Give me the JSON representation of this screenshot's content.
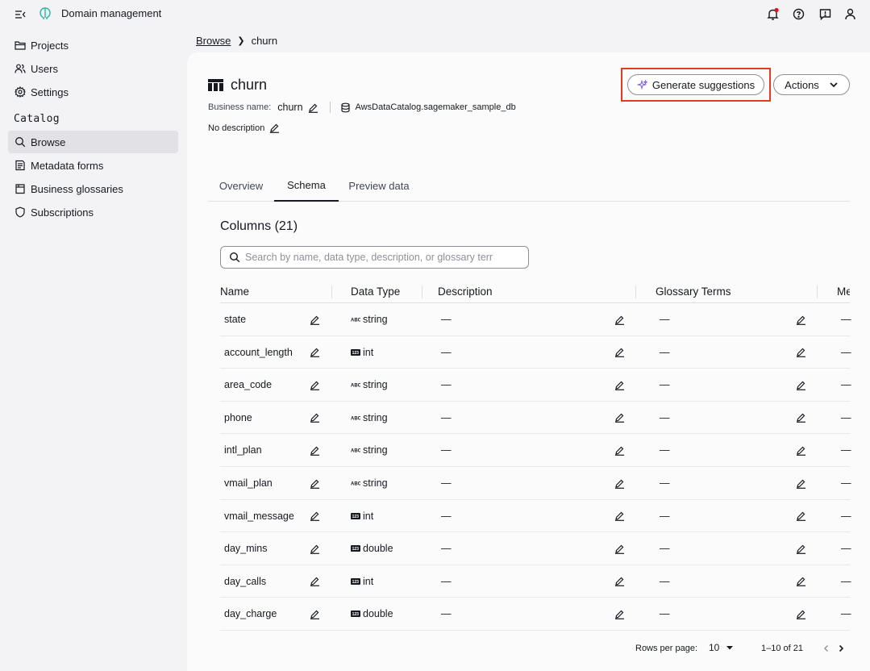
{
  "topbar": {
    "app_title": "Domain management",
    "notification_dot_color": "#d91515"
  },
  "sidebar": {
    "items": [
      {
        "label": "Projects",
        "icon": "folder-icon"
      },
      {
        "label": "Users",
        "icon": "users-icon"
      },
      {
        "label": "Settings",
        "icon": "gear-icon"
      }
    ],
    "section_label": "Catalog",
    "catalog_items": [
      {
        "label": "Browse",
        "icon": "search-icon",
        "active": true
      },
      {
        "label": "Metadata forms",
        "icon": "form-icon"
      },
      {
        "label": "Business glossaries",
        "icon": "book-icon"
      },
      {
        "label": "Subscriptions",
        "icon": "shield-icon"
      }
    ]
  },
  "breadcrumb": {
    "parent": "Browse",
    "current": "churn"
  },
  "header": {
    "title": "churn",
    "business_name_label": "Business name:",
    "business_name": "churn",
    "database": "AwsDataCatalog.sagemaker_sample_db",
    "description": "No description",
    "generate_label": "Generate suggestions",
    "actions_label": "Actions",
    "highlight_color": "#e8391f"
  },
  "tabs": [
    {
      "label": "Overview",
      "active": false
    },
    {
      "label": "Schema",
      "active": true
    },
    {
      "label": "Preview data",
      "active": false
    }
  ],
  "columns": {
    "title": "Columns (21)",
    "search_placeholder": "Search by name, data type, description, or glossary terr",
    "headers": [
      "Name",
      "Data Type",
      "Description",
      "Glossary Terms",
      "Me"
    ],
    "rows": [
      {
        "name": "state",
        "type": "string",
        "type_icon": "abc-icon",
        "description": "—",
        "glossary": "—",
        "meta": "—"
      },
      {
        "name": "account_length",
        "type": "int",
        "type_icon": "123-icon",
        "description": "—",
        "glossary": "—",
        "meta": "—"
      },
      {
        "name": "area_code",
        "type": "string",
        "type_icon": "abc-icon",
        "description": "—",
        "glossary": "—",
        "meta": "—"
      },
      {
        "name": "phone",
        "type": "string",
        "type_icon": "abc-icon",
        "description": "—",
        "glossary": "—",
        "meta": "—"
      },
      {
        "name": "intl_plan",
        "type": "string",
        "type_icon": "abc-icon",
        "description": "—",
        "glossary": "—",
        "meta": "—"
      },
      {
        "name": "vmail_plan",
        "type": "string",
        "type_icon": "abc-icon",
        "description": "—",
        "glossary": "—",
        "meta": "—"
      },
      {
        "name": "vmail_message",
        "type": "int",
        "type_icon": "123-icon",
        "description": "—",
        "glossary": "—",
        "meta": "—"
      },
      {
        "name": "day_mins",
        "type": "double",
        "type_icon": "123-icon",
        "description": "—",
        "glossary": "—",
        "meta": "—"
      },
      {
        "name": "day_calls",
        "type": "int",
        "type_icon": "123-icon",
        "description": "—",
        "glossary": "—",
        "meta": "—"
      },
      {
        "name": "day_charge",
        "type": "double",
        "type_icon": "123-icon",
        "description": "—",
        "glossary": "—",
        "meta": "—"
      }
    ]
  },
  "pagination": {
    "rows_per_page_label": "Rows per page:",
    "rows_per_page": "10",
    "range": "1–10 of 21"
  }
}
